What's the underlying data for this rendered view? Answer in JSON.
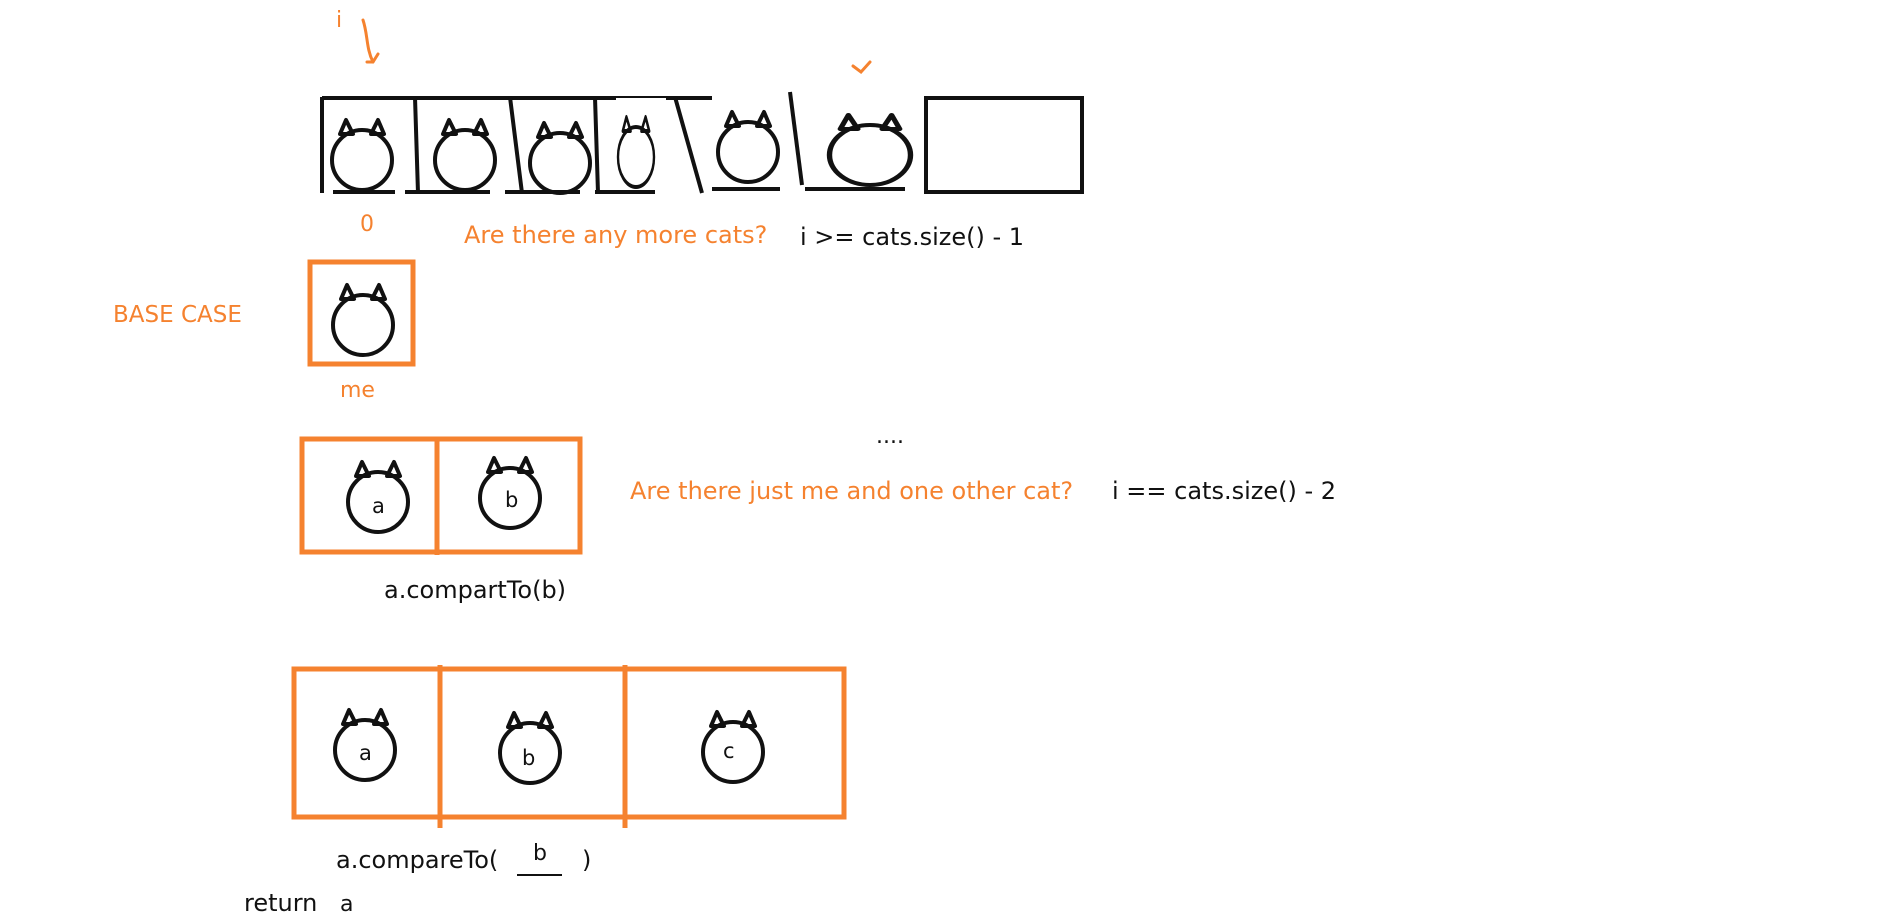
{
  "colors": {
    "accent": "#f5822f",
    "ink": "#111111",
    "background": "#ffffff"
  },
  "top": {
    "index_label": "i",
    "zero_label": "0",
    "question": "Are there any more cats?",
    "condition": "i >= cats.size() - 1"
  },
  "base_case": {
    "label": "BASE CASE",
    "me_label": "me"
  },
  "ellipsis": "....",
  "two_cats": {
    "a": "a",
    "b": "b",
    "question": "Are there just me and one other cat?",
    "condition": "i == cats.size() - 2",
    "call": "a.compartTo(b)"
  },
  "three_cats": {
    "a": "a",
    "b": "b",
    "c": "c",
    "call_prefix": "a.compareTo(",
    "call_blank_value": "b",
    "call_suffix": ")",
    "return_keyword": "return",
    "return_value": "a"
  }
}
